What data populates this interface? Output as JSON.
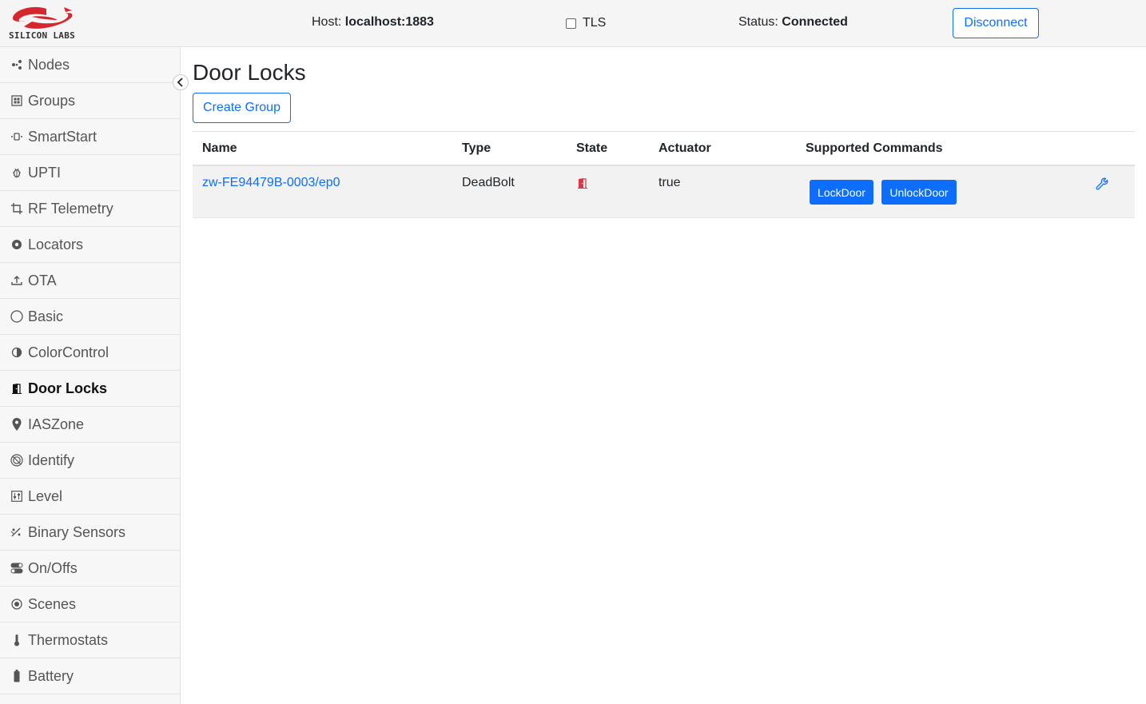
{
  "header": {
    "logo_text": "SILICON LABS",
    "host_label": "Host:",
    "host_value": "localhost:1883",
    "tls_label": "TLS",
    "status_label": "Status:",
    "status_value": "Connected",
    "disconnect_label": "Disconnect",
    "brand_color": "#d6272f"
  },
  "sidebar": {
    "items": [
      {
        "label": "Nodes",
        "icon": "nodes-icon"
      },
      {
        "label": "Groups",
        "icon": "groups-icon"
      },
      {
        "label": "SmartStart",
        "icon": "smartstart-icon"
      },
      {
        "label": "UPTI",
        "icon": "bug-icon"
      },
      {
        "label": "RF Telemetry",
        "icon": "crop-icon"
      },
      {
        "label": "Locators",
        "icon": "locator-icon"
      },
      {
        "label": "OTA",
        "icon": "upload-icon"
      },
      {
        "label": "Basic",
        "icon": "circle-icon"
      },
      {
        "label": "ColorControl",
        "icon": "contrast-icon"
      },
      {
        "label": "Door Locks",
        "icon": "door-icon",
        "active": true
      },
      {
        "label": "IASZone",
        "icon": "pin-icon"
      },
      {
        "label": "Identify",
        "icon": "identify-icon"
      },
      {
        "label": "Level",
        "icon": "sliders-icon"
      },
      {
        "label": "Binary Sensors",
        "icon": "sensor-icon"
      },
      {
        "label": "On/Offs",
        "icon": "toggle-icon"
      },
      {
        "label": "Scenes",
        "icon": "scene-icon"
      },
      {
        "label": "Thermostats",
        "icon": "thermometer-icon"
      },
      {
        "label": "Battery",
        "icon": "battery-icon"
      }
    ]
  },
  "main": {
    "title": "Door Locks",
    "create_group_label": "Create Group",
    "table": {
      "columns": [
        "Name",
        "Type",
        "State",
        "Actuator",
        "Supported Commands"
      ],
      "rows": [
        {
          "name": "zw-FE94479B-0003/ep0",
          "type": "DeadBolt",
          "state_icon": "door-open-icon",
          "state_color": "#dc3545",
          "actuator": "true",
          "commands": [
            "LockDoor",
            "UnlockDoor"
          ],
          "action_icon": "wrench-icon"
        }
      ]
    }
  },
  "colors": {
    "primary": "#0d6efd",
    "danger": "#dc3545"
  }
}
